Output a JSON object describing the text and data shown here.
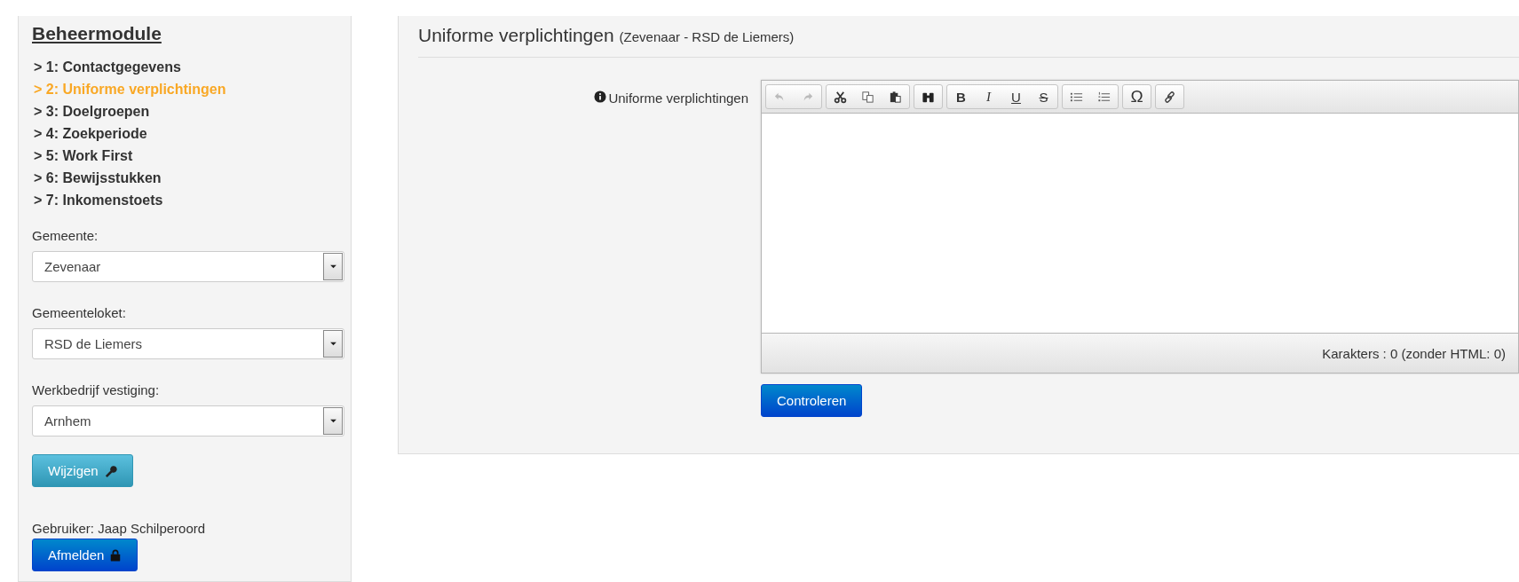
{
  "sidebar": {
    "title": "Beheermodule",
    "nav": [
      {
        "label": "> 1: Contactgegevens",
        "selected": false
      },
      {
        "label": "> 2: Uniforme verplichtingen",
        "selected": true
      },
      {
        "label": "> 3: Doelgroepen",
        "selected": false
      },
      {
        "label": "> 4: Zoekperiode",
        "selected": false
      },
      {
        "label": "> 5: Work First",
        "selected": false
      },
      {
        "label": "> 6: Bewijsstukken",
        "selected": false
      },
      {
        "label": "> 7: Inkomenstoets",
        "selected": false
      }
    ],
    "fields": [
      {
        "label": "Gemeente:",
        "value": "Zevenaar"
      },
      {
        "label": "Gemeenteloket:",
        "value": "RSD de Liemers"
      },
      {
        "label": "Werkbedrijf vestiging:",
        "value": "Arnhem"
      }
    ],
    "edit_button": "Wijzigen",
    "user": "Gebruiker: Jaap Schilperoord",
    "logout_button": "Afmelden"
  },
  "panel": {
    "title": "Uniforme verplichtingen",
    "subtitle": "(Zevenaar - RSD de Liemers)",
    "field_label": "Uniforme verplichtingen",
    "editor": {
      "toolbar": [
        [
          {
            "kind": "undo",
            "disabled": true
          },
          {
            "kind": "redo",
            "disabled": true
          }
        ],
        [
          {
            "kind": "cut",
            "disabled": false
          },
          {
            "kind": "copy",
            "disabled": false
          },
          {
            "kind": "paste",
            "disabled": false
          }
        ],
        [
          {
            "kind": "find",
            "disabled": false
          }
        ],
        [
          {
            "kind": "bold",
            "label": "B",
            "disabled": false
          },
          {
            "kind": "italic",
            "label": "I",
            "disabled": false
          },
          {
            "kind": "underline",
            "label": "U",
            "disabled": false
          },
          {
            "kind": "strike",
            "label": "S",
            "disabled": false
          }
        ],
        [
          {
            "kind": "bullets",
            "disabled": false
          },
          {
            "kind": "numbers",
            "disabled": false
          }
        ],
        [
          {
            "kind": "symbol",
            "label": "Ω",
            "disabled": false
          }
        ],
        [
          {
            "kind": "link",
            "disabled": false
          }
        ]
      ],
      "counter": "Karakters : 0 (zonder HTML: 0)"
    },
    "check_button": "Controleren"
  }
}
